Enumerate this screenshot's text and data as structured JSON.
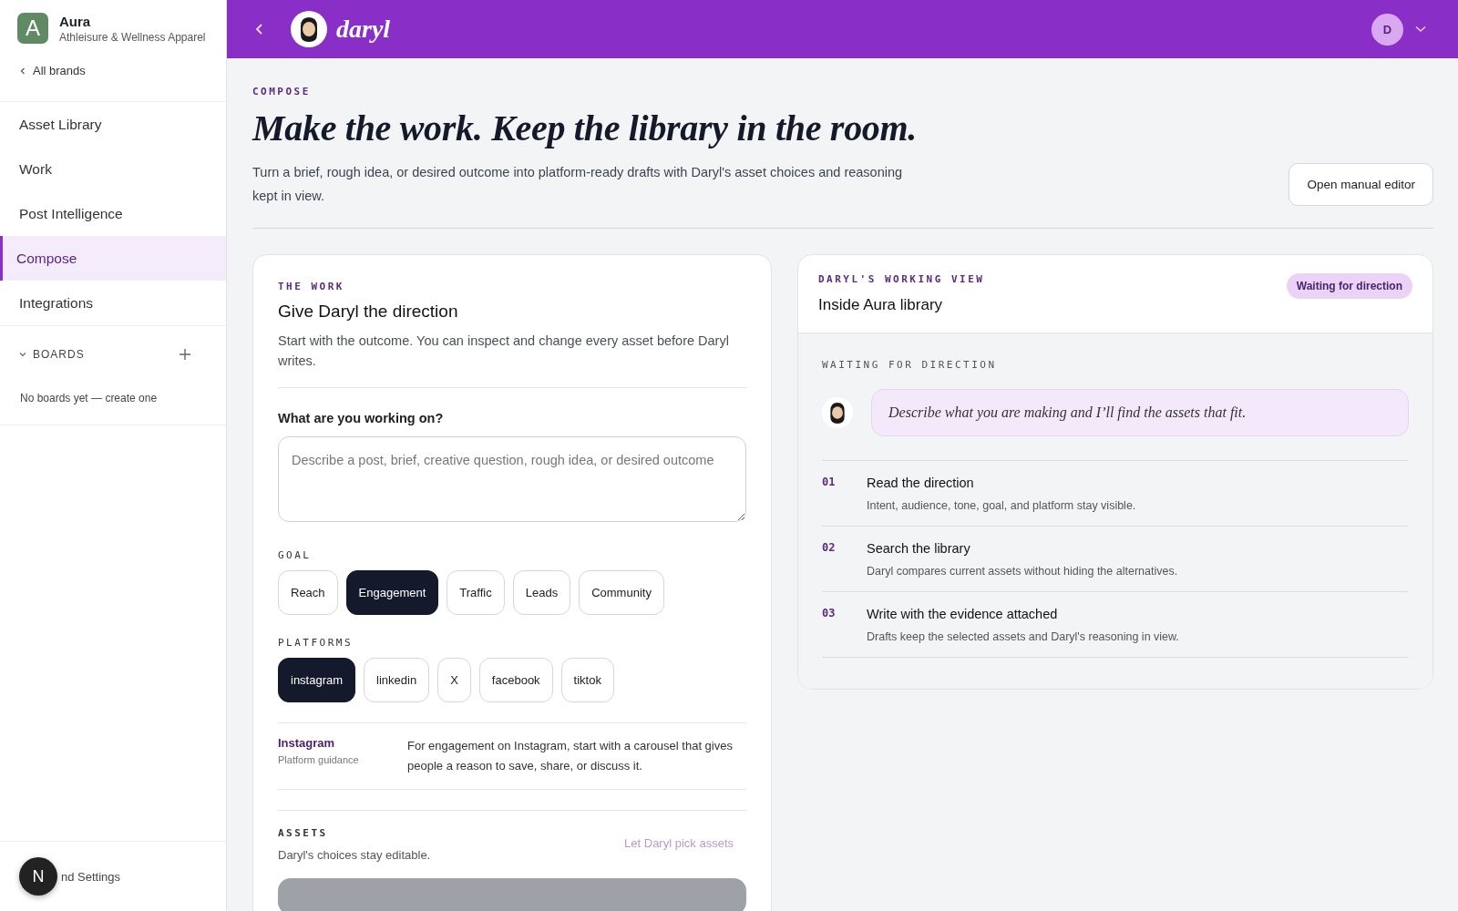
{
  "brand": {
    "initial": "A",
    "name": "Aura",
    "tagline": "Athleisure & Wellness Apparel"
  },
  "back_link": "All brands",
  "nav": [
    {
      "label": "Asset Library",
      "selected": false
    },
    {
      "label": "Work",
      "selected": false
    },
    {
      "label": "Post Intelligence",
      "selected": false
    },
    {
      "label": "Compose",
      "selected": true
    },
    {
      "label": "Integrations",
      "selected": false
    }
  ],
  "boards": {
    "title": "BOARDS",
    "expanded": true,
    "empty": "No boards yet — create one"
  },
  "sidebar_footer": {
    "badge": "N",
    "label": "nd Settings"
  },
  "header": {
    "app_name": "daryl",
    "avatar": "D"
  },
  "page": {
    "eyebrow": "COMPOSE",
    "title": "Make the work. Keep the library in the room.",
    "intro": "Turn a brief, rough idea, or desired outcome into platform-ready drafts with Daryl's asset choices and reasoning kept in view.",
    "action": "Open manual editor"
  },
  "work": {
    "eyebrow": "THE WORK",
    "title": "Give Daryl the direction",
    "intro": "Start with the outcome. You can inspect and change every asset before Daryl writes.",
    "question": "What are you working on?",
    "placeholder": "Describe a post, brief, creative question, rough idea, or desired outcome",
    "goal_label": "GOAL",
    "goals": [
      {
        "label": "Reach",
        "selected": false
      },
      {
        "label": "Engagement",
        "selected": true
      },
      {
        "label": "Traffic",
        "selected": false
      },
      {
        "label": "Leads",
        "selected": false
      },
      {
        "label": "Community",
        "selected": false
      }
    ],
    "platforms_label": "PLATFORMS",
    "platforms": [
      {
        "label": "instagram",
        "selected": true
      },
      {
        "label": "linkedin",
        "selected": false
      },
      {
        "label": "X",
        "selected": false
      },
      {
        "label": "facebook",
        "selected": false
      },
      {
        "label": "tiktok",
        "selected": false
      }
    ],
    "guidance": {
      "platform": "Instagram",
      "caption": "Platform guidance",
      "text": "For engagement on Instagram, start with a carousel that gives people a reason to save, share, or discuss it."
    },
    "assets": {
      "label": "ASSETS",
      "note": "Daryl's choices stay editable.",
      "action": "Let Daryl pick assets"
    }
  },
  "working_view": {
    "eyebrow": "DARYL'S WORKING VIEW",
    "title": "Inside Aura library",
    "status": "Waiting for direction",
    "section": "WAITING FOR DIRECTION",
    "message": "Describe what you are making and I’ll find the assets that fit.",
    "steps": [
      {
        "number": "01",
        "title": "Read the direction",
        "text": "Intent, audience, tone, goal, and platform stay visible."
      },
      {
        "number": "02",
        "title": "Search the library",
        "text": "Daryl compares current assets without hiding the alternatives."
      },
      {
        "number": "03",
        "title": "Write with the evidence attached",
        "text": "Drafts keep the selected assets and Daryl's reasoning in view."
      }
    ]
  }
}
